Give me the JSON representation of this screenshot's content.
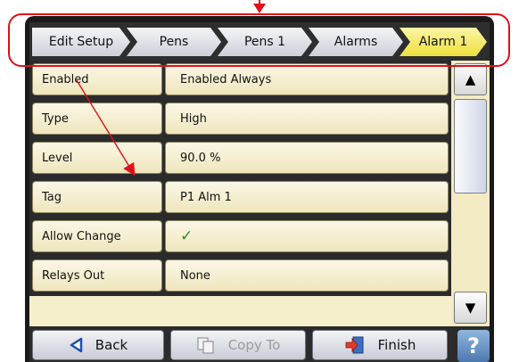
{
  "breadcrumb": [
    {
      "label": "Edit Setup"
    },
    {
      "label": "Pens"
    },
    {
      "label": "Pens 1"
    },
    {
      "label": "Alarms"
    },
    {
      "label": "Alarm 1"
    }
  ],
  "rows": [
    {
      "label": "Enabled",
      "value": "Enabled Always"
    },
    {
      "label": "Type",
      "value": "High"
    },
    {
      "label": "Level",
      "value": "90.0 %"
    },
    {
      "label": "Tag",
      "value": "P1 Alm 1"
    },
    {
      "label": "Allow Change",
      "value": "✓"
    },
    {
      "label": "Relays Out",
      "value": "None"
    }
  ],
  "scroll": {
    "up_icon": "▲",
    "down_icon": "▼"
  },
  "bottom": {
    "back_label": "Back",
    "copy_label": "Copy To",
    "finish_label": "Finish",
    "help_label": "?"
  },
  "colors": {
    "panel_bg": "#f6efcc",
    "active_crumb": "#eedf3c",
    "annotation_red": "#e0101a",
    "check_green": "#2e8b23"
  }
}
